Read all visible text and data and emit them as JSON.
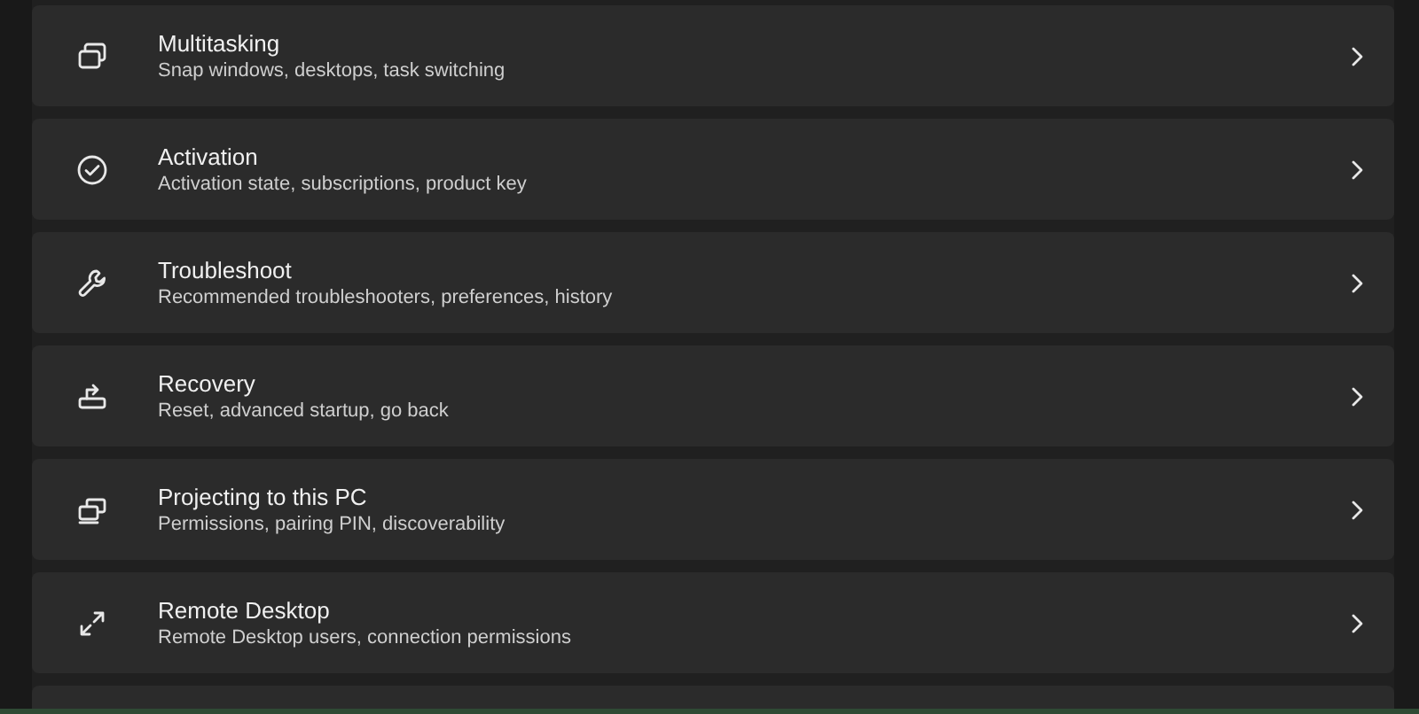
{
  "items": [
    {
      "title": "Multitasking",
      "subtitle": "Snap windows, desktops, task switching"
    },
    {
      "title": "Activation",
      "subtitle": "Activation state, subscriptions, product key"
    },
    {
      "title": "Troubleshoot",
      "subtitle": "Recommended troubleshooters, preferences, history"
    },
    {
      "title": "Recovery",
      "subtitle": "Reset, advanced startup, go back"
    },
    {
      "title": "Projecting to this PC",
      "subtitle": "Permissions, pairing PIN, discoverability"
    },
    {
      "title": "Remote Desktop",
      "subtitle": "Remote Desktop users, connection permissions"
    }
  ]
}
